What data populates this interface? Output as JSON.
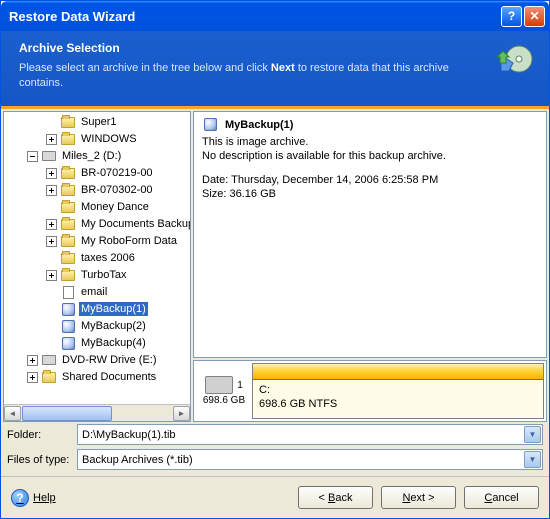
{
  "title": "Restore Data Wizard",
  "header": {
    "title": "Archive Selection",
    "sub_before": "Please select an archive in the tree below and click ",
    "sub_bold": "Next",
    "sub_after": " to restore data that this archive contains."
  },
  "tree": {
    "items": {
      "super1": "Super1",
      "windows": "WINDOWS",
      "miles2": "Miles_2 (D:)",
      "br1": "BR-070219-00",
      "br2": "BR-070302-00",
      "money": "Money Dance",
      "mydocs": "My Documents Backup",
      "robo": "My RoboForm Data",
      "taxes": "taxes 2006",
      "turbo": "TurboTax",
      "email": "email",
      "backup1": "MyBackup(1)",
      "backup2": "MyBackup(2)",
      "backup4": "MyBackup(4)",
      "dvd": "DVD-RW Drive (E:)",
      "shared": "Shared Documents"
    }
  },
  "info": {
    "title": "MyBackup(1)",
    "line1": "This is image archive.",
    "line2": "No description is available for this backup archive.",
    "line3": "Date: Thursday, December 14, 2006 6:25:58 PM",
    "line4": "Size: 36.16 GB"
  },
  "disk": {
    "index": "1",
    "total": "698.6 GB",
    "name": "C:",
    "detail": "698.6 GB  NTFS"
  },
  "form": {
    "folder_label": "Folder:",
    "folder_value": "D:\\MyBackup(1).tib",
    "type_label": "Files of type:",
    "type_value": "Backup Archives (*.tib)"
  },
  "footer": {
    "help": "Help",
    "back": "Back",
    "next": "Next",
    "cancel": "Cancel"
  }
}
